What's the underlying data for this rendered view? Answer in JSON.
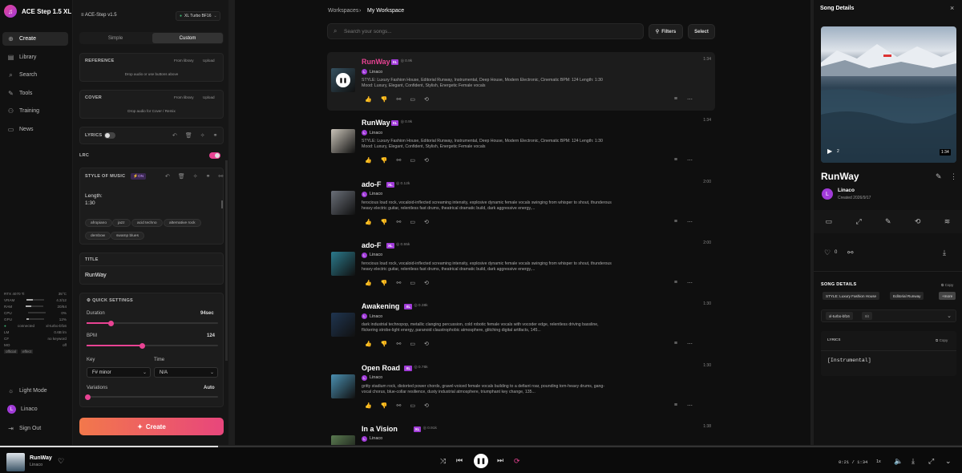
{
  "app": {
    "name": "ACE Step 1.5 XL"
  },
  "nav": {
    "items": [
      {
        "label": "Create",
        "icon": "plus-circle-icon"
      },
      {
        "label": "Library",
        "icon": "library-icon"
      },
      {
        "label": "Search",
        "icon": "search-icon"
      },
      {
        "label": "Tools",
        "icon": "tools-icon"
      },
      {
        "label": "Training",
        "icon": "training-icon"
      },
      {
        "label": "News",
        "icon": "news-icon"
      }
    ],
    "light_mode": "Light Mode",
    "user": "Linaco",
    "user_initial": "L",
    "sign_out": "Sign Out"
  },
  "gpu": {
    "name": "RTX 4070 Ti",
    "temp": "35°C",
    "vram_label": "VRAM",
    "vram": "4.3/12",
    "vram_pct": 36,
    "ram_label": "RAM",
    "ram": "20/64",
    "ram_pct": 31,
    "cpu_label": "CPU",
    "cpu": "0%",
    "cpu_pct": 0,
    "gpu_label": "GPU",
    "gpu": "12%",
    "gpu_pct": 12,
    "status": "connected",
    "model": "xl-turbo-bf16",
    "lm_label": "LM",
    "lm": "0.6B lm",
    "lora_label": "CF",
    "lora": "no keyword",
    "mo_label": "MO",
    "mo": "off",
    "badges": [
      "official",
      "effect"
    ]
  },
  "create": {
    "header": "ACE-Step v1.5",
    "model": "XL Turbo BF16",
    "tabs": [
      "Simple",
      "Custom"
    ],
    "reference": {
      "title": "REFERENCE",
      "from_library": "From library",
      "upload": "Upload",
      "hint": "Drop audio or use buttons above"
    },
    "cover": {
      "title": "COVER",
      "from_library": "From library",
      "upload": "Upload",
      "hint": "Drop audio for Cover / Remix"
    },
    "lyrics_label": "LYRICS",
    "lrc_label": "LRC",
    "style": {
      "title": "STYLE OF MUSIC",
      "on": "ON",
      "text_line1": "Length:",
      "text_line2": "1:30",
      "chips": [
        "afropiano",
        "jazz",
        "acid techno",
        "alternative rock",
        "dembow",
        "swamp blues"
      ]
    },
    "title_label": "TITLE",
    "title_value": "RunWay",
    "quick": {
      "title": "QUICK SETTINGS",
      "duration_label": "Duration",
      "duration_value": "94sec",
      "duration_pct": 0.18,
      "bpm_label": "BPM",
      "bpm_value": "124",
      "bpm_pct": 0.42,
      "key_label": "Key",
      "key_value": "F# minor",
      "time_label": "Time",
      "time_value": "N/A",
      "variations_label": "Variations",
      "variations_value": "Auto"
    },
    "create_button": "Create"
  },
  "main": {
    "crumb_root": "Workspaces",
    "crumb_current": "My Workspace",
    "search_placeholder": "Search your songs...",
    "filters": "Filters",
    "select": "Select",
    "songs": [
      {
        "title": "RunWay",
        "badge": "XL",
        "plays": "0.9k",
        "duration": "1:34",
        "artist": "Linaco",
        "desc": "STYLE: Luxury Fashion House, Editorial Runway, Instrumental, Deep House, Modern Electronic, Cinematic BPM: 124 Length: 1:30 Mood: Luxury, Elegant, Confident, Stylish, Energetic Female vocals",
        "thumb": "#35505f",
        "active": true
      },
      {
        "title": "RunWay",
        "badge": "XL",
        "plays": "0.9k",
        "duration": "1:34",
        "artist": "Linaco",
        "desc": "STYLE: Luxury Fashion House, Editorial Runway, Instrumental, Deep House, Modern Electronic, Cinematic BPM: 124 Length: 1:30 Mood: Luxury, Elegant, Confident, Stylish, Energetic Female vocals",
        "thumb": "#c9c3b8"
      },
      {
        "title": "ado-F",
        "badge": "XL",
        "plays": "0.12k",
        "duration": "2:00",
        "artist": "Linaco",
        "desc": "ferocious loud rock, vocaloid-inflected screaming intensity, explosive dynamic female vocals swinging from whisper to shout, thunderous heavy electric guitar, relentless fast drums, theatrical dramatic build, dark aggressive energy,...",
        "thumb": "#6a6f78"
      },
      {
        "title": "ado-F",
        "badge": "XL",
        "plays": "0.55k",
        "duration": "2:00",
        "artist": "Linaco",
        "desc": "ferocious loud rock, vocaloid-inflected screaming intensity, explosive dynamic female vocals swinging from whisper to shout, thunderous heavy electric guitar, relentless fast drums, theatrical dramatic build, dark aggressive energy,...",
        "thumb": "#2b7a8c"
      },
      {
        "title": "Awakening",
        "badge": "XL",
        "plays": "0.38k",
        "duration": "1:30",
        "artist": "Linaco",
        "desc": "dark industrial technopop, metallic clanging percussion, cold robotic female vocals with vocoder edge, relentless driving bassline, flickering strobe-light energy, paranoid claustrophobic atmosphere, glitching digital artifacts, 145...",
        "thumb": "#1f3550"
      },
      {
        "title": "Open Road",
        "badge": "XL",
        "plays": "0.76k",
        "duration": "1:30",
        "artist": "Linaco",
        "desc": "gritty stadium rock, distorted power chords, gravel-voiced female vocals building to a defiant roar, pounding tom-heavy drums, gang-vocal chorus, blue-collar resilience, dusty industrial atmosphere, triumphant key change, 135...",
        "thumb": "#4a8fb0"
      },
      {
        "title": "In a Vision",
        "badge": "XL",
        "plays": "0.91k",
        "duration": "1:38",
        "artist": "Linaco",
        "desc": "",
        "thumb": "#5a7a50"
      }
    ]
  },
  "details": {
    "header": "Song Details",
    "video_count": "2",
    "video_time": "1:34",
    "title": "RunWay",
    "artist": "Linaco",
    "artist_initial": "L",
    "created": "Created 2026/9/17",
    "likes": "0",
    "section_title": "SONG DETAILS",
    "copy": "Copy",
    "tags": [
      "STYLE: Luxury Fashion House",
      "Editorial Runway"
    ],
    "more": "+more",
    "model": "xl-turbo-bf16",
    "model_badge": "8it",
    "lyrics_title": "LYRICS",
    "lyrics_copy": "Copy",
    "lyrics_text": "[Instrumental]"
  },
  "player": {
    "title": "RunWay",
    "artist": "Linaco",
    "time": "0:21 / 1:34",
    "speed": "1x",
    "progress": 0.227
  }
}
